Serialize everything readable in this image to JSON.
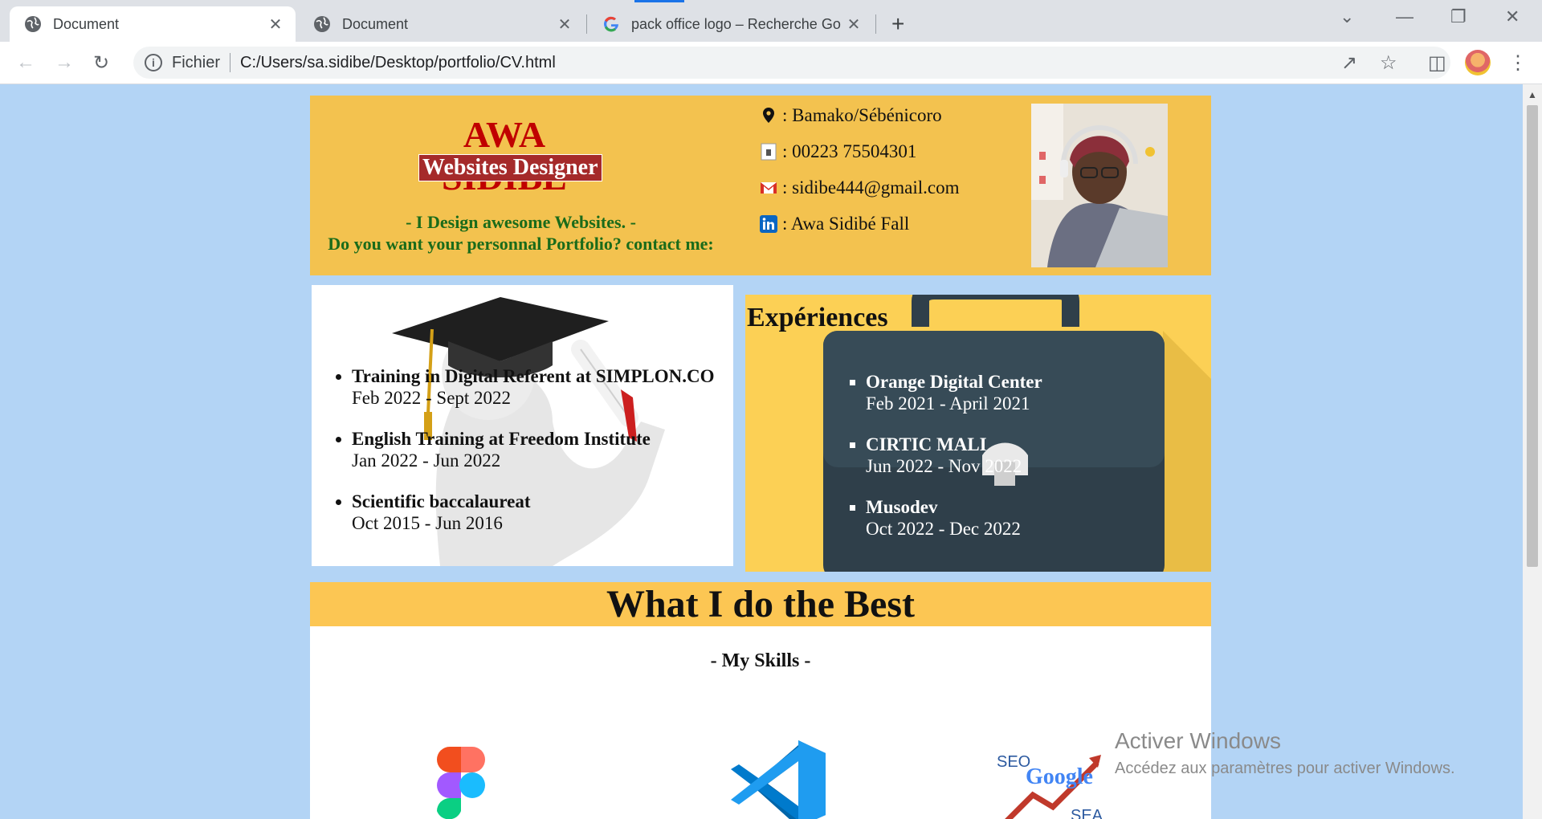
{
  "browser": {
    "tabs": [
      {
        "title": "Document",
        "close": "✕"
      },
      {
        "title": "Document",
        "close": "✕"
      },
      {
        "title": "pack office logo – Recherche Go",
        "close": "✕"
      }
    ],
    "new_tab": "+",
    "address": {
      "scheme_label": "Fichier",
      "url": "C:/Users/sa.sidibe/Desktop/portfolio/CV.html"
    }
  },
  "header": {
    "name": "AWA SIDIBE",
    "role": "Websites Designer",
    "tagline1": "- I Design awesome Websites. -",
    "tagline2": "Do you want your personnal Portfolio? contact me:",
    "contacts": [
      {
        "icon": "location-pin-icon",
        "text": ": Bamako/Sébénicoro"
      },
      {
        "icon": "phone-icon",
        "text": ": 00223 75504301"
      },
      {
        "icon": "gmail-icon",
        "text": ": sidibe444@gmail.com"
      },
      {
        "icon": "linkedin-icon",
        "text": ": Awa Sidibé Fall"
      }
    ]
  },
  "education": [
    {
      "title": "Training in Digital Referent at SIMPLON.CO",
      "dates": "Feb 2022 - Sept 2022"
    },
    {
      "title": "English Training at Freedom Institute",
      "dates": "Jan 2022 - Jun 2022"
    },
    {
      "title": "Scientific baccalaureat",
      "dates": "Oct 2015 - Jun 2016"
    }
  ],
  "experience": {
    "title": "Expériences",
    "items": [
      {
        "title": "Orange Digital Center",
        "dates": "Feb 2021 - April 2021"
      },
      {
        "title": "CIRTIC MALI",
        "dates": "Jun 2022 - Nov 2022"
      },
      {
        "title": "Musodev",
        "dates": "Oct 2022 - Dec 2022"
      }
    ]
  },
  "best": {
    "title": "What I do the Best",
    "subtitle": "- My Skills -"
  },
  "skills": [
    {
      "icon": "figma-logo-icon"
    },
    {
      "icon": "vscode-logo-icon"
    },
    {
      "icon": "seo-google-logo-icon",
      "label": "SEO",
      "label2": "Google",
      "label3": "SEA"
    }
  ],
  "watermark": {
    "line1": "Activer Windows",
    "line2": "Accédez aux paramètres pour activer Windows."
  }
}
